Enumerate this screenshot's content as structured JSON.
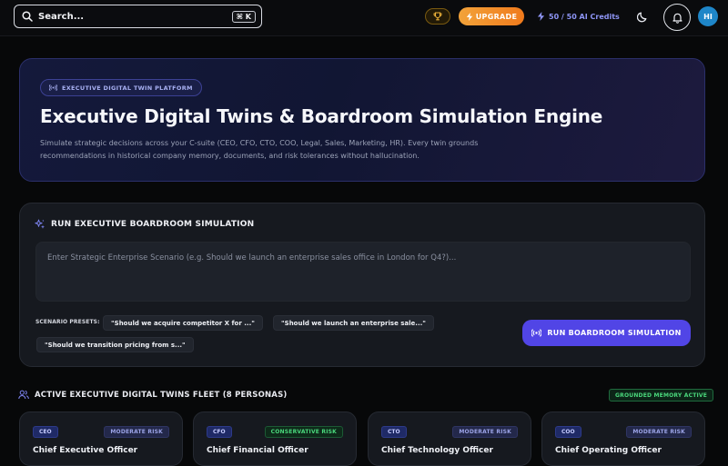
{
  "topbar": {
    "search_placeholder": "Search...",
    "search_shortcut": "⌘ K",
    "upgrade_label": "UPGRADE",
    "credits_label": "50 / 50 AI Credits",
    "avatar_initials": "HI",
    "accent_color": "#5145e6",
    "icons": [
      "search-icon",
      "trophy-icon",
      "bolt-icon",
      "moon-icon",
      "bell-icon"
    ]
  },
  "hero": {
    "badge": "EXECUTIVE DIGITAL TWIN PLATFORM",
    "title": "Executive Digital Twins & Boardroom Simulation Engine",
    "description": "Simulate strategic decisions across your C-suite (CEO, CFO, CTO, COO, Legal, Sales, Marketing, HR). Every twin grounds recommendations in historical company memory, documents, and risk tolerances without hallucination."
  },
  "simulation": {
    "heading": "RUN EXECUTIVE BOARDROOM SIMULATION",
    "input_placeholder": "Enter Strategic Enterprise Scenario (e.g. Should we launch an enterprise sales office in London for Q4?)...",
    "input_value": "",
    "presets_label": "SCENARIO PRESETS:",
    "presets": [
      "\"Should we acquire competitor X for ...\"",
      "\"Should we launch an enterprise sale...\"",
      "\"Should we transition pricing from s...\""
    ],
    "run_button": "RUN BOARDROOM SIMULATION"
  },
  "fleet": {
    "heading": "ACTIVE EXECUTIVE DIGITAL TWINS FLEET (8 PERSONAS)",
    "status_badge": "GROUNDED MEMORY ACTIVE",
    "cards": [
      {
        "role": "CEO",
        "risk": "MODERATE RISK",
        "title": "Chief Executive Officer"
      },
      {
        "role": "CFO",
        "risk": "CONSERVATIVE RISK",
        "title": "Chief Financial Officer"
      },
      {
        "role": "CTO",
        "risk": "MODERATE RISK",
        "title": "Chief Technology Officer"
      },
      {
        "role": "COO",
        "risk": "MODERATE RISK",
        "title": "Chief Operating Officer"
      }
    ]
  }
}
